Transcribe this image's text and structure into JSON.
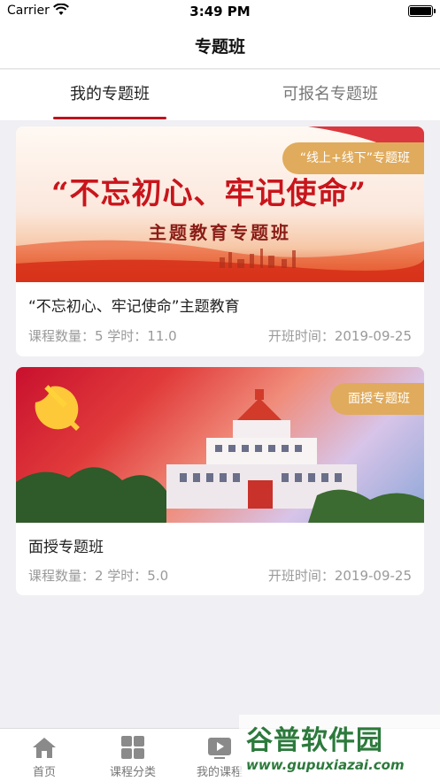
{
  "status_bar": {
    "carrier": "Carrier",
    "time": "3:49 PM"
  },
  "nav": {
    "title": "专题班"
  },
  "tabs": [
    {
      "label": "我的专题班",
      "active": true
    },
    {
      "label": "可报名专题班",
      "active": false
    }
  ],
  "courses": [
    {
      "badge": "“线上+线下”专题班",
      "banner_headline": "“不忘初心、牢记使命”",
      "banner_subtitle": "主题教育专题班",
      "title": "“不忘初心、牢记使命”主题教育",
      "stats": "课程数量：5 学时：11.0",
      "date": "开班时间：2019-09-25"
    },
    {
      "badge": "面授专题班",
      "title": "面授专题班",
      "stats": "课程数量：2 学时：5.0",
      "date": "开班时间：2019-09-25"
    }
  ],
  "tabbar": [
    {
      "label": "首页",
      "icon": "home-icon"
    },
    {
      "label": "课程分类",
      "icon": "grid-icon"
    },
    {
      "label": "我的课程",
      "icon": "play-icon"
    }
  ],
  "watermark": {
    "main": "谷普软件园",
    "sub": "www.gupuxiazai.com"
  },
  "colors": {
    "accent": "#c1121b",
    "badge": "#e0ab5c",
    "background": "#efeff4"
  }
}
